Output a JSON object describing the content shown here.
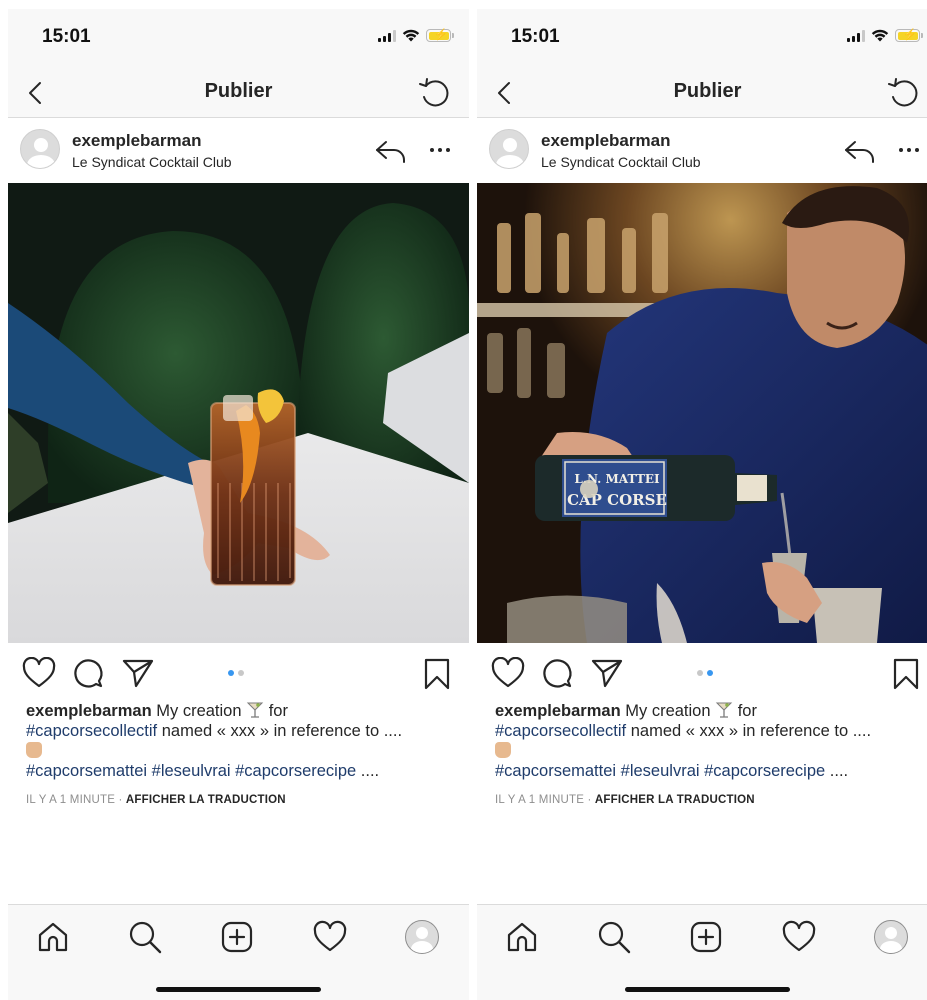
{
  "status_bar": {
    "time": "15:01"
  },
  "nav": {
    "title": "Publier"
  },
  "post": {
    "username": "exemplebarman",
    "location": "Le Syndicat Cocktail Club"
  },
  "caption": {
    "username": "exemplebarman",
    "text_1": "My creation",
    "text_2": "for",
    "hashtag_1": "#capcorsecollectif",
    "text_3": "named « xxx » in reference to ....",
    "hashtag_2": "#capcorsemattei",
    "hashtag_3": "#leseulvrai",
    "hashtag_4": "#capcorserecipe",
    "text_4": "....",
    "emoji_1": "martini-glass-emoji",
    "emoji_2": "raised-fist-emoji"
  },
  "meta": {
    "time_ago": "IL Y A 1 MINUTE",
    "separator": "·",
    "translate_label": "AFFICHER LA TRADUCTION"
  },
  "screens": [
    {
      "image": "cocktail-glass-on-table-photo",
      "carousel_active_index": 0,
      "carousel_count": 2
    },
    {
      "image": "bartender-pouring-cap-corse-photo",
      "carousel_active_index": 1,
      "carousel_count": 2
    }
  ],
  "bottle_label": {
    "brand": "L.N. MATTEI",
    "name": "CAP CORSE"
  },
  "colors": {
    "accent_blue": "#3897f0",
    "hashtag": "#1f3c6b",
    "meta_grey": "#8e8e8e",
    "text": "#262626",
    "bar_background": "#f8f8f8"
  },
  "icons": [
    "back-icon",
    "undo-icon",
    "reply-icon",
    "more-icon",
    "like-icon",
    "comment-icon",
    "share-icon",
    "save-icon",
    "home-icon",
    "search-icon",
    "add-post-icon",
    "activity-icon",
    "profile-icon"
  ]
}
